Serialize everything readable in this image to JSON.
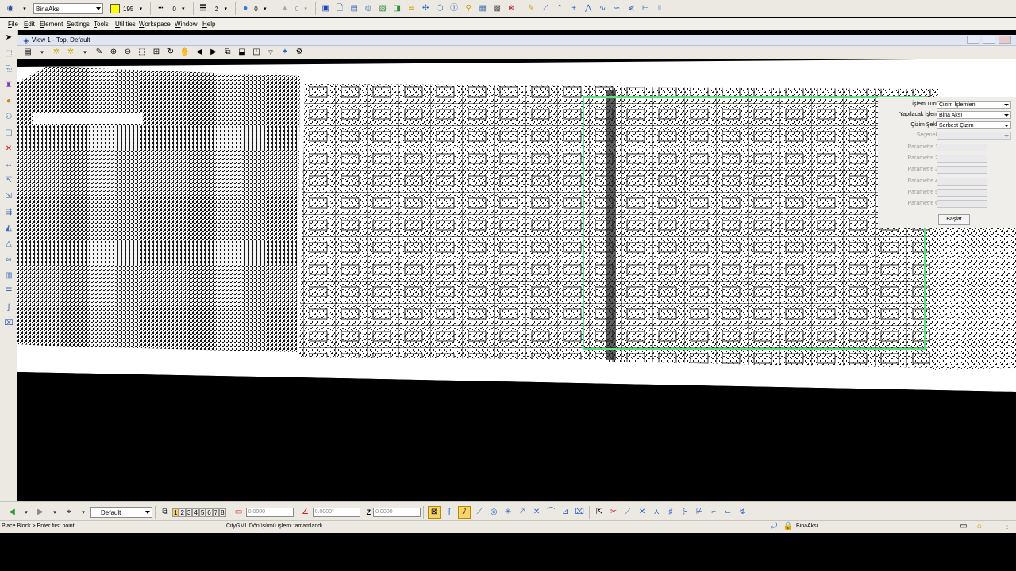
{
  "toolbar": {
    "level": "BinaAksi",
    "color_number": "195",
    "line_style": "0",
    "line_weight": "2",
    "transparency": "0",
    "priority": "0"
  },
  "menu": [
    "File",
    "Edit",
    "Element",
    "Settings",
    "Tools",
    "Utilities",
    "Workspace",
    "Window",
    "Help"
  ],
  "view": {
    "title": "View 1 - Top, Default"
  },
  "dialog": {
    "rows": [
      {
        "label": "İşlem Türü",
        "value": "Çizim İşlemleri"
      },
      {
        "label": "Yapılacak İşlem",
        "value": "Bina Aksı"
      },
      {
        "label": "Çizim Şekli",
        "value": "Serbest Çizim"
      },
      {
        "label": "Seçenek",
        "value": ""
      }
    ],
    "params": [
      "Parametre 1",
      "Parametre 2",
      "Parametre 3",
      "Parametre 4",
      "Parametre 5",
      "Parametre 6"
    ],
    "start_label": "Başlat"
  },
  "bottom": {
    "view_group": "Default",
    "view_numbers": [
      "1",
      "2",
      "3",
      "4",
      "5",
      "6",
      "7",
      "8"
    ],
    "x": "0.0000",
    "angle": "0.0000°",
    "z_label": "Z",
    "z": "0.0000"
  },
  "status": {
    "prompt": "Place Block > Enter first point",
    "message": "CityGML Dönüşümü işlemi tamamlandı.",
    "active_level": "BinaAksi"
  },
  "colors": {
    "selection_box": "#58e07e",
    "active_color": "#ffff00"
  }
}
